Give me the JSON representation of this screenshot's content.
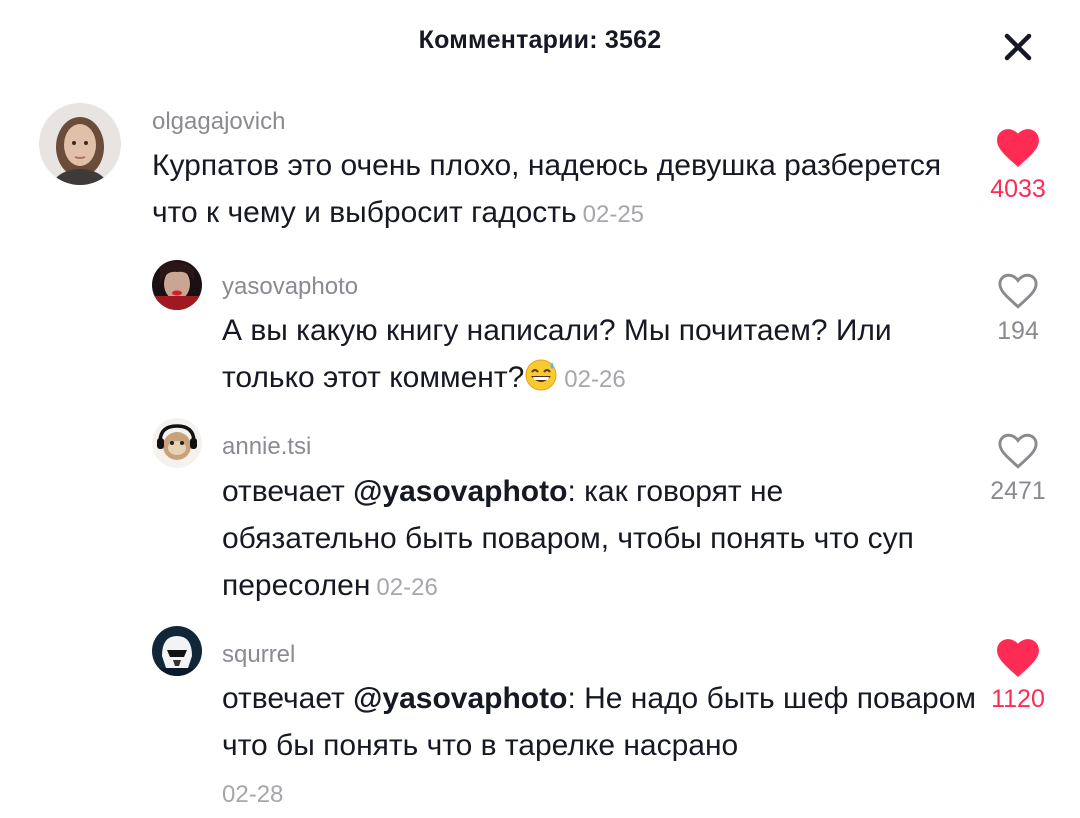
{
  "header": {
    "title": "Комментарии: 3562"
  },
  "comments": [
    {
      "username": "olgagajovich",
      "text": "Курпатов это очень плохо, надеюсь девушка разберется что к чему и выбросит гадость",
      "date": "02-25",
      "likes": "4033",
      "liked": true
    },
    {
      "username": "yasovaphoto",
      "text": "А вы какую книгу написали? Мы почитаем? Или только этот коммент?",
      "emoji": "grinning-sweat-emoji",
      "date": "02-26",
      "likes": "194",
      "liked": false
    },
    {
      "username": "annie.tsi",
      "prefix": "отвечает ",
      "mention": "@yasovaphoto",
      "text": ": как говорят не обязательно быть поваром, чтобы понять что суп пересолен",
      "date": "02-26",
      "likes": "2471",
      "liked": false
    },
    {
      "username": "squrrel",
      "prefix": "отвечает ",
      "mention": "@yasovaphoto",
      "text": ": Не надо быть шеф поваром что бы понять что в тарелке насрано",
      "date": "02-28",
      "likes": "1120",
      "liked": true
    }
  ],
  "colors": {
    "like_active": "#fe2c55",
    "muted": "#8a8b91",
    "text": "#161823"
  }
}
